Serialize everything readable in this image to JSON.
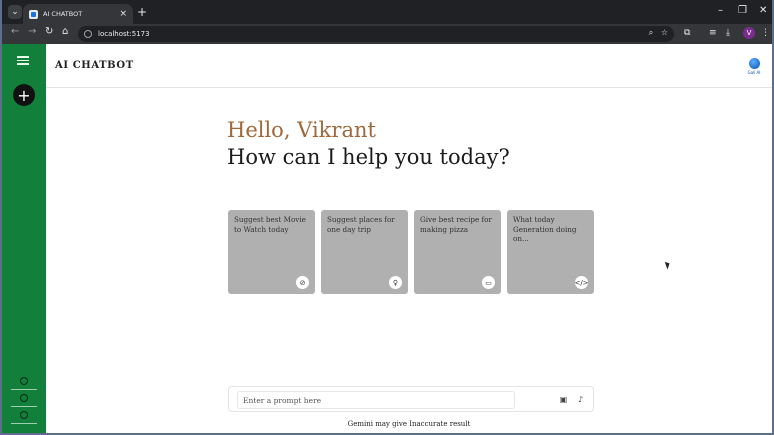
{
  "browser": {
    "tab_title": "AI CHATBOT",
    "url": "localhost:5173",
    "profile_initial": "V"
  },
  "app": {
    "title": "AI CHATBOT",
    "logo_caption": "Gali AI"
  },
  "greeting": {
    "hello": "Hello, Vikrant",
    "question": "How can I help you today?"
  },
  "cards": [
    {
      "text": "Suggest best Movie to Watch today",
      "icon": "compass-icon"
    },
    {
      "text": "Suggest places for one day trip",
      "icon": "bulb-icon"
    },
    {
      "text": "Give best recipe for making pizza",
      "icon": "message-icon"
    },
    {
      "text": "What today Generation doing on...",
      "icon": "code-icon"
    }
  ],
  "prompt": {
    "placeholder": "Enter a prompt here"
  },
  "disclaimer": "Gemini may give Inaccurate result",
  "colors": {
    "sidebar": "#12803a",
    "card": "#b0b0b0",
    "hello": "#a0683a"
  }
}
